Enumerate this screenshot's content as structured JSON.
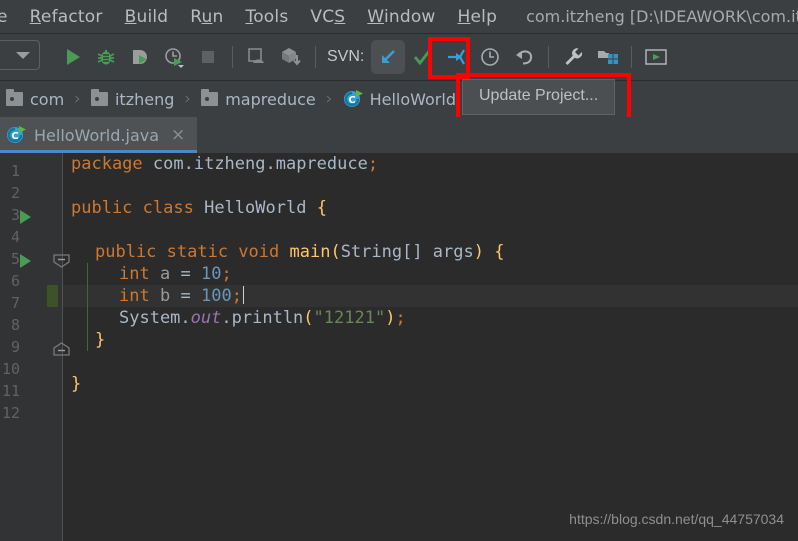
{
  "window": {
    "project_title": "com.itzheng [D:\\IDEAWORK\\com.itzh"
  },
  "menubar": {
    "items": [
      {
        "label": "e",
        "truncated": true
      },
      {
        "mnemonic": "R",
        "rest": "efactor"
      },
      {
        "mnemonic": "B",
        "rest": "uild"
      },
      {
        "pre": "R",
        "mnemonic": "u",
        "rest": "n"
      },
      {
        "mnemonic": "T",
        "rest": "ools"
      },
      {
        "pre": "VC",
        "mnemonic": "S",
        "rest": ""
      },
      {
        "mnemonic": "W",
        "rest": "indow"
      },
      {
        "mnemonic": "H",
        "rest": "elp"
      }
    ]
  },
  "toolbar": {
    "run_config_label": "",
    "svn_label": "SVN:",
    "buttons": [
      {
        "name": "run-button",
        "title": "Run"
      },
      {
        "name": "debug-button",
        "title": "Debug"
      },
      {
        "name": "run-with-coverage-button",
        "title": "Run with Coverage"
      },
      {
        "name": "profiler-button",
        "title": "Profile"
      },
      {
        "name": "stop-button",
        "title": "Stop"
      },
      {
        "name": "build-project-button",
        "title": "Build Project"
      },
      {
        "name": "sync-module-button",
        "title": "Sync Module"
      },
      {
        "name": "update-project-button",
        "title": "Update Project..."
      },
      {
        "name": "commit-button",
        "title": "Commit"
      },
      {
        "name": "compare-with-latest-button",
        "title": "Compare with Latest"
      },
      {
        "name": "show-history-button",
        "title": "Show History"
      },
      {
        "name": "rollback-button",
        "title": "Rollback"
      },
      {
        "name": "settings-button",
        "title": "Settings"
      },
      {
        "name": "project-structure-button",
        "title": "Project Structure"
      },
      {
        "name": "run-window-button",
        "title": "Run Window"
      }
    ],
    "highlight_color": "#ff0000"
  },
  "tooltip": {
    "text": "Update Project..."
  },
  "breadcrumb": {
    "items": [
      {
        "label": "com",
        "icon": "folder-icon"
      },
      {
        "label": "itzheng",
        "icon": "folder-icon"
      },
      {
        "label": "mapreduce",
        "icon": "folder-icon"
      },
      {
        "label": "HelloWorld",
        "icon": "java-class-icon"
      }
    ],
    "separator": "›"
  },
  "editor_tab": {
    "label": "HelloWorld.java",
    "close": "×"
  },
  "editor": {
    "line_numbers": [
      "1",
      "2",
      "3",
      "4",
      "5",
      "6",
      "7",
      "8",
      "9",
      "10",
      "11",
      "12"
    ],
    "lines": [
      {
        "n": 1,
        "text": "package com.itzheng.mapreduce;"
      },
      {
        "n": 2,
        "text": ""
      },
      {
        "n": 3,
        "text": "public class HelloWorld {"
      },
      {
        "n": 4,
        "text": ""
      },
      {
        "n": 5,
        "text": "    public static void main(String[] args) {"
      },
      {
        "n": 6,
        "text": "        int a = 10;"
      },
      {
        "n": 7,
        "text": "        int b = 100;"
      },
      {
        "n": 8,
        "text": "        System.out.println(\"12121\");"
      },
      {
        "n": 9,
        "text": "    }"
      },
      {
        "n": 10,
        "text": ""
      },
      {
        "n": 11,
        "text": "}"
      },
      {
        "n": 12,
        "text": ""
      }
    ],
    "caret_line": 7,
    "modified_line": 7,
    "run_marker_lines": [
      3,
      5
    ],
    "colors": {
      "background": "#2b2b2b",
      "gutter": "#313335",
      "keyword": "#cc7832",
      "number": "#6897bb",
      "string": "#6a8759",
      "identifier": "#a9b7c6",
      "method": "#ffc66d",
      "static_field": "#9876aa",
      "line_number": "#606366"
    }
  },
  "watermark": {
    "text": "https://blog.csdn.net/qq_44757034"
  }
}
